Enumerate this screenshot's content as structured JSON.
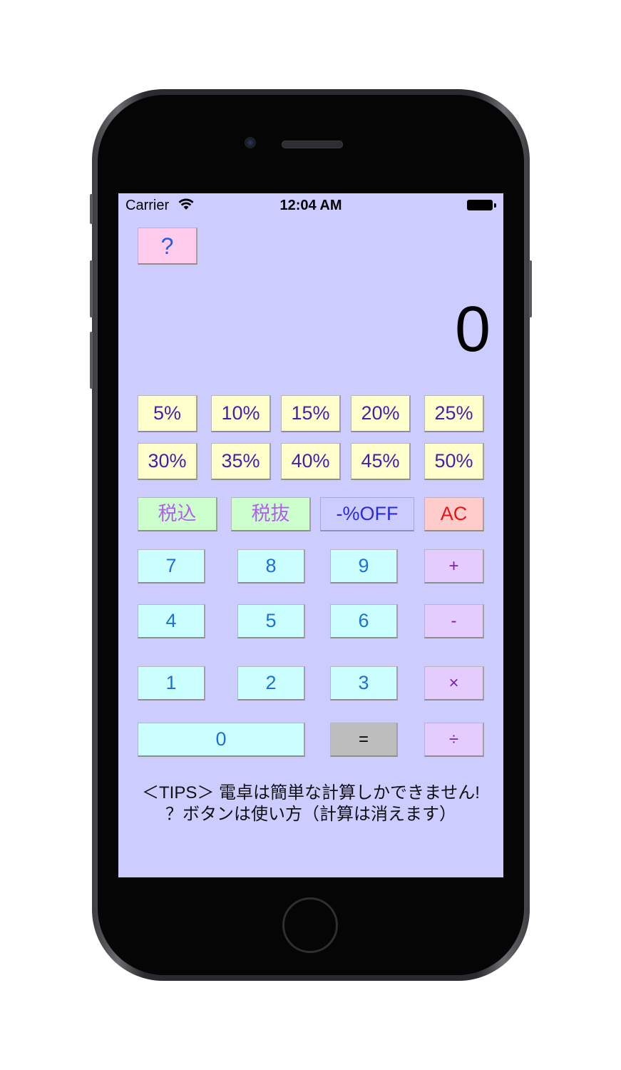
{
  "status_bar": {
    "carrier": "Carrier",
    "time": "12:04 AM"
  },
  "help_button": {
    "label": "?"
  },
  "display": {
    "value": "0"
  },
  "percent_buttons": [
    "5%",
    "10%",
    "15%",
    "20%",
    "25%",
    "30%",
    "35%",
    "40%",
    "45%",
    "50%"
  ],
  "function_buttons": {
    "tax_included": "税込",
    "tax_excluded": "税抜",
    "percent_off": "-%OFF",
    "all_clear": "AC"
  },
  "digits": {
    "seven": "7",
    "eight": "8",
    "nine": "9",
    "four": "4",
    "five": "5",
    "six": "6",
    "one": "1",
    "two": "2",
    "three": "3",
    "zero": "0"
  },
  "operators": {
    "plus": "+",
    "minus": "-",
    "multiply": "×",
    "divide": "÷",
    "equals": "="
  },
  "tips": {
    "line1": "＜TIPS＞ 電卓は簡単な計算しかできません!",
    "line2": "？ボタンは使い方（計算は消えます）"
  },
  "colors": {
    "screen_background": "#ccccff",
    "percent_button": "#ffffcc",
    "tax_button": "#ccffcc",
    "digit_button": "#ccffff",
    "operator_button": "#e4ccff",
    "clear_button": "#ffcccc",
    "help_button": "#ffccee",
    "equals_button": "#bdbdbd"
  }
}
